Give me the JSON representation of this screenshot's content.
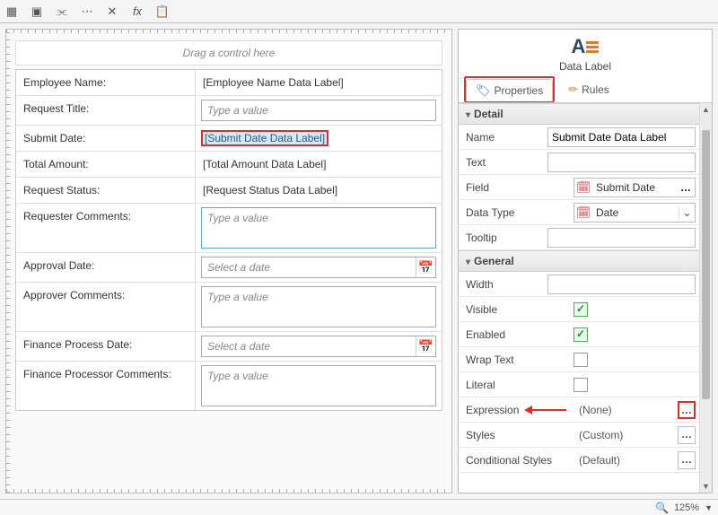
{
  "toolbar": {
    "icons": [
      "form-icon",
      "image-icon",
      "link-icon",
      "more-icon",
      "tools-icon",
      "fx-icon",
      "paste-icon"
    ]
  },
  "designer": {
    "drop_hint": "Drag a control here",
    "rows": [
      {
        "label": "Employee Name:",
        "type": "datalabel",
        "value": "[Employee Name Data Label]"
      },
      {
        "label": "Request Title:",
        "type": "textbox",
        "placeholder": "Type a value"
      },
      {
        "label": "Submit Date:",
        "type": "datalabel-selected",
        "value": "[Submit Date Data Label]"
      },
      {
        "label": "Total Amount:",
        "type": "datalabel",
        "value": "[Total Amount Data Label]"
      },
      {
        "label": "Request Status:",
        "type": "datalabel",
        "value": "[Request Status Data Label]"
      },
      {
        "label": "Requester Comments:",
        "type": "textarea-focused",
        "placeholder": "Type a value"
      },
      {
        "label": "Approval Date:",
        "type": "datepicker",
        "placeholder": "Select a date"
      },
      {
        "label": "Approver Comments:",
        "type": "textarea",
        "placeholder": "Type a value"
      },
      {
        "label": "Finance Process Date:",
        "type": "datepicker",
        "placeholder": "Select a date"
      },
      {
        "label": "Finance Processor Comments:",
        "type": "textarea",
        "placeholder": "Type a value"
      }
    ]
  },
  "panel": {
    "title": "Data Label",
    "tabs": {
      "properties": "Properties",
      "rules": "Rules"
    },
    "sections": {
      "detail": {
        "title": "Detail",
        "name_label": "Name",
        "name_value": "Submit Date Data Label",
        "text_label": "Text",
        "text_value": "",
        "field_label": "Field",
        "field_value": "Submit Date",
        "datatype_label": "Data Type",
        "datatype_value": "Date",
        "tooltip_label": "Tooltip",
        "tooltip_value": ""
      },
      "general": {
        "title": "General",
        "width_label": "Width",
        "width_value": "",
        "visible_label": "Visible",
        "visible_checked": "true",
        "enabled_label": "Enabled",
        "enabled_checked": "true",
        "wrap_label": "Wrap Text",
        "wrap_checked": "false",
        "literal_label": "Literal",
        "literal_checked": "false",
        "expr_label": "Expression",
        "expr_value": "(None)",
        "styles_label": "Styles",
        "styles_value": "(Custom)",
        "cond_label": "Conditional Styles",
        "cond_value": "(Default)"
      }
    }
  },
  "statusbar": {
    "zoom": "125%"
  }
}
